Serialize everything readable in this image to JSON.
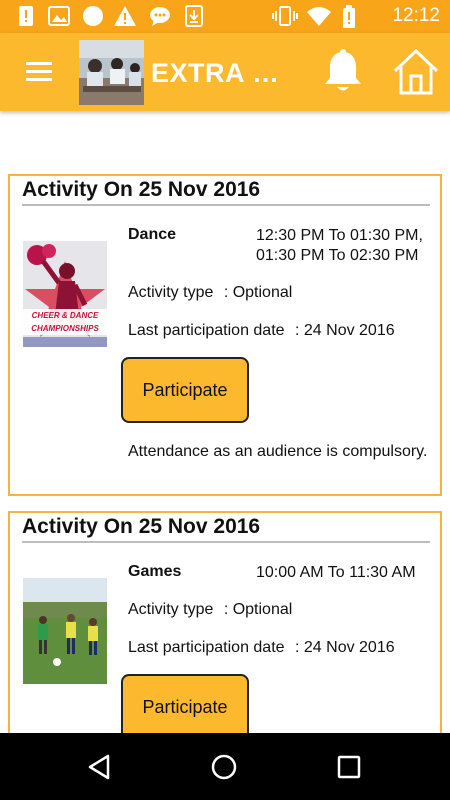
{
  "status_bar": {
    "time": "12:12",
    "left_icons": [
      "alert-box-icon",
      "image-icon",
      "circle-icon",
      "warning-icon",
      "chat-bubble-icon",
      "download-icon"
    ],
    "right_icons": [
      "vibrate-icon",
      "wifi-icon",
      "battery-alert-icon"
    ]
  },
  "toolbar": {
    "title": "EXTRA C...",
    "menu_icon": "hamburger-menu-icon",
    "bell_icon": "bell-icon",
    "home_icon": "home-icon"
  },
  "activities": [
    {
      "heading": "Activity On 25 Nov 2016",
      "name": "Dance",
      "time": "12:30 PM To 01:30 PM, 01:30 PM To 02:30 PM",
      "type_label": "Activity type",
      "type_value": ": Optional",
      "date_label": "Last participation date",
      "date_value": ": 24 Nov 2016",
      "button_label": "Participate",
      "note": "Attendance as an audience is compulsory.",
      "image_text": "CHEER & DANCE CHAMPIONSHIPS"
    },
    {
      "heading": "Activity On 25 Nov 2016",
      "name": "Games",
      "time": "10:00 AM To 11:30 AM",
      "type_label": "Activity type",
      "type_value": ": Optional",
      "date_label": "Last participation date",
      "date_value": ": 24 Nov 2016",
      "button_label": "Participate"
    }
  ],
  "nav_bar": {
    "icons": [
      "back-icon",
      "home-circle-icon",
      "recents-icon"
    ]
  },
  "colors": {
    "primary": "#fdb92e",
    "status_bar": "#f8a51a",
    "card_border": "#f5b342",
    "nav_bar": "#000000"
  }
}
